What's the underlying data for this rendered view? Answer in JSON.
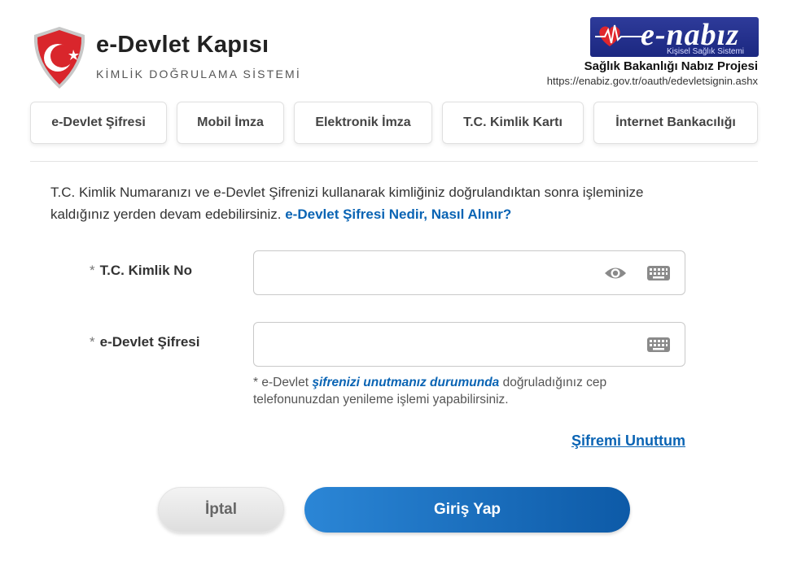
{
  "header": {
    "title": "e-Devlet Kapısı",
    "subtitle": "KİMLİK DOĞRULAMA SİSTEMİ",
    "partner_brand": "e-nabız",
    "partner_tagline": "Kişisel Sağlık Sistemi",
    "partner_name": "Sağlık Bakanlığı Nabız Projesi",
    "partner_url": "https://enabiz.gov.tr/oauth/edevletsignin.ashx"
  },
  "tabs": [
    {
      "label": "e-Devlet Şifresi"
    },
    {
      "label": "Mobil İmza"
    },
    {
      "label": "Elektronik İmza"
    },
    {
      "label": "T.C. Kimlik Kartı"
    },
    {
      "label": "İnternet Bankacılığı"
    }
  ],
  "intro": {
    "text": "T.C. Kimlik Numaranızı ve e-Devlet Şifrenizi kullanarak kimliğiniz doğrulandıktan sonra işleminize kaldığınız yerden devam edebilirsiniz.",
    "link": "e-Devlet Şifresi Nedir, Nasıl Alınır?"
  },
  "form": {
    "required_mark": "*",
    "tckn_label": "T.C. Kimlik No",
    "tckn_value": "",
    "password_label": "e-Devlet Şifresi",
    "password_value": "",
    "note_prefix": "* e-Devlet",
    "note_emphasis": "şifrenizi unutmanız durumunda",
    "note_suffix": "doğruladığınız cep telefonunuzdan yenileme işlemi yapabilirsiniz.",
    "forgot_link": "Şifremi Unuttum"
  },
  "buttons": {
    "cancel": "İptal",
    "login": "Giriş Yap"
  },
  "icons": {
    "show": "eye-icon",
    "keyboard": "keyboard-icon"
  },
  "colors": {
    "brand_red": "#d9262c",
    "link_blue": "#0a64b4",
    "primary_blue": "#1a6fc1"
  }
}
